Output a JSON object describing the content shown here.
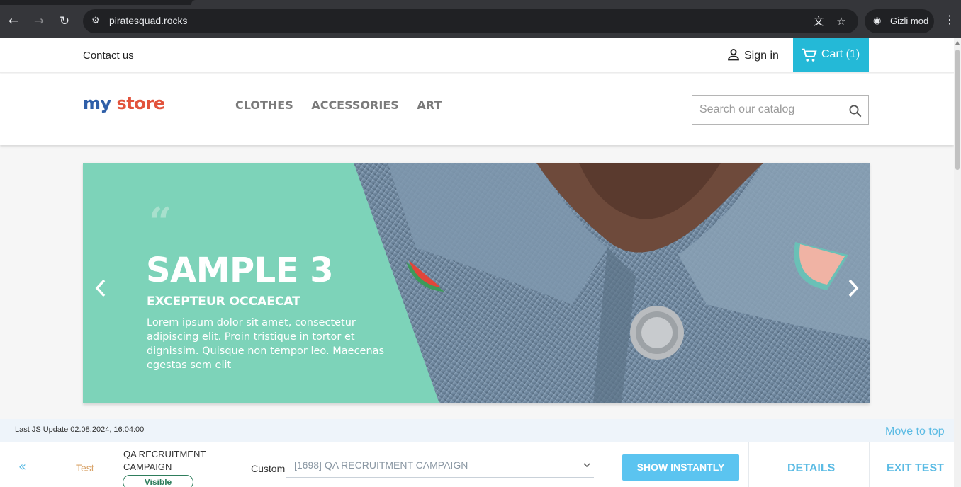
{
  "browser": {
    "url": "piratesquad.rocks",
    "incognito_label": "Gizli mod",
    "icons": [
      "back-icon",
      "forward-icon",
      "reload-icon",
      "site-info-icon",
      "translate-icon",
      "bookmark-star-icon",
      "incognito-icon",
      "menu-kebab-icon"
    ]
  },
  "store": {
    "contact": "Contact us",
    "signin": "Sign in",
    "cart": "Cart (1)",
    "logo_parts": [
      "my",
      "store"
    ],
    "menu": [
      "CLOTHES",
      "ACCESSORIES",
      "ART"
    ],
    "search_placeholder": "Search our catalog",
    "colors": {
      "accent": "#24b9d7",
      "slide_green": "#7dd3b9"
    }
  },
  "slide": {
    "quote": "“",
    "title": "SAMPLE 3",
    "subtitle": "EXCEPTEUR OCCAECAT",
    "text": "Lorem ipsum dolor sit amet, consectetur adipiscing elit. Proin tristique in tortor et dignissim. Quisque non tempor leo. Maecenas egestas sem elit"
  },
  "testbar": {
    "last_update": "Last JS Update 02.08.2024, 16:04:00",
    "move_to_top": "Move to top",
    "collapse": "«",
    "test_label": "Test",
    "campaign": "QA RECRUITMENT CAMPAIGN",
    "visible_badge": "Visible",
    "custom_label": "Custom",
    "select_value": "[1698] QA RECRUITMENT CAMPAIGN",
    "show_button": "SHOW INSTANTLY",
    "details": "DETAILS",
    "exit": "EXIT TEST"
  }
}
